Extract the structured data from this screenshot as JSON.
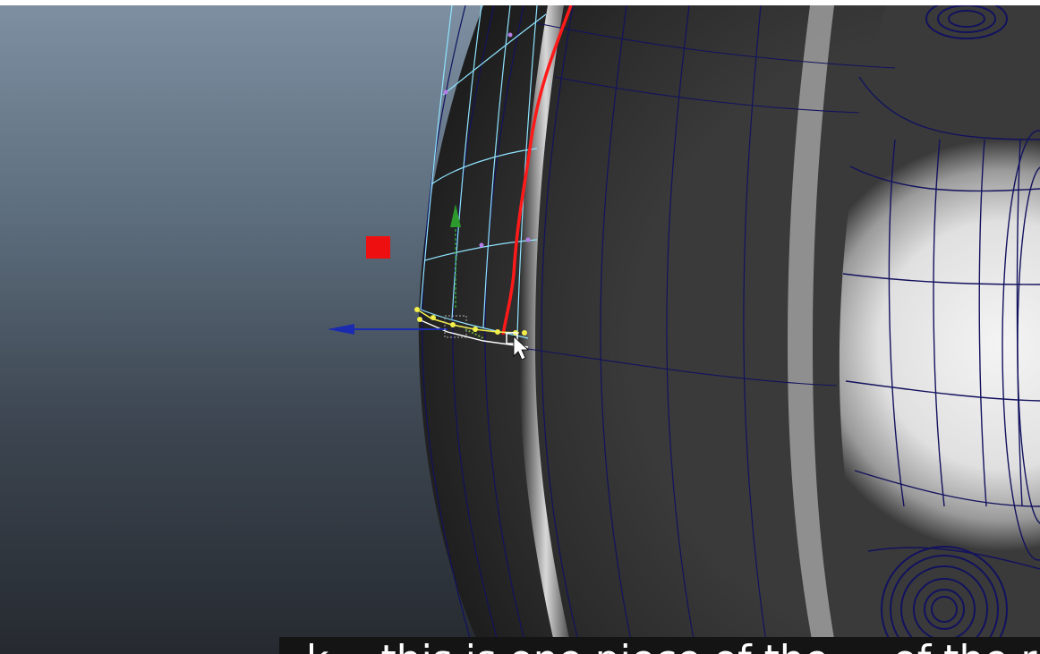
{
  "viewport": {
    "label": "3D modeling viewport - wheel rim mesh",
    "background_top": "#7d8fa1",
    "background_bottom": "#262a30",
    "wire_color": "#12125e",
    "selection_wire_color": "#8fe3ff",
    "vertex_color": "#f2ee4a",
    "red_edge_color": "#ff1a1a",
    "move_y_axis_color": "#2e9a2e",
    "move_x_axis_color": "#1a2bb0"
  },
  "gizmo": {
    "center_handle_icon": "square-handle-icon",
    "y_axis_icon": "arrow-up-icon",
    "x_axis_icon": "arrow-left-icon"
  },
  "toolbar": {
    "red_marker_icon": "red-square-icon"
  },
  "caption": {
    "text": "k… this is one piece of the … of the rim looks"
  }
}
